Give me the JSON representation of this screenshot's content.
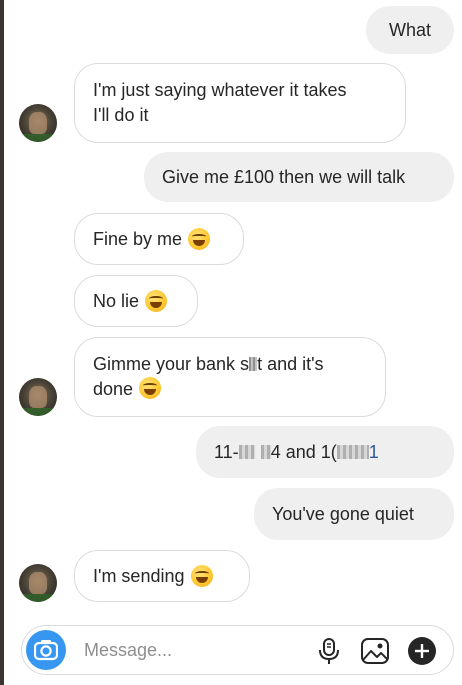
{
  "messages": [
    {
      "side": "out",
      "text": "What"
    },
    {
      "side": "in",
      "lines": [
        "I'm just saying whatever it takes",
        "I'll do it"
      ]
    },
    {
      "side": "out",
      "text": "Give me £100 then we will talk"
    },
    {
      "side": "in",
      "text": "Fine by me"
    },
    {
      "side": "in",
      "text": "No lie"
    },
    {
      "side": "in",
      "lines": [
        "Gimme your bank s",
        "t and it's",
        "done"
      ]
    },
    {
      "side": "out",
      "parts": [
        "11-",
        "4 and 1("
      ]
    },
    {
      "side": "out",
      "text": "You've gone quiet"
    },
    {
      "side": "in",
      "text": "I'm sending"
    }
  ],
  "composer": {
    "placeholder": "Message...",
    "icons": [
      "camera-icon",
      "microphone-icon",
      "image-gallery-icon",
      "add-icon"
    ]
  },
  "colors": {
    "outgoing_bubble": "#efefef",
    "incoming_border": "#dbdbdb",
    "camera_button": "#3797f0"
  },
  "emoji": "face-with-tears-of-joy"
}
